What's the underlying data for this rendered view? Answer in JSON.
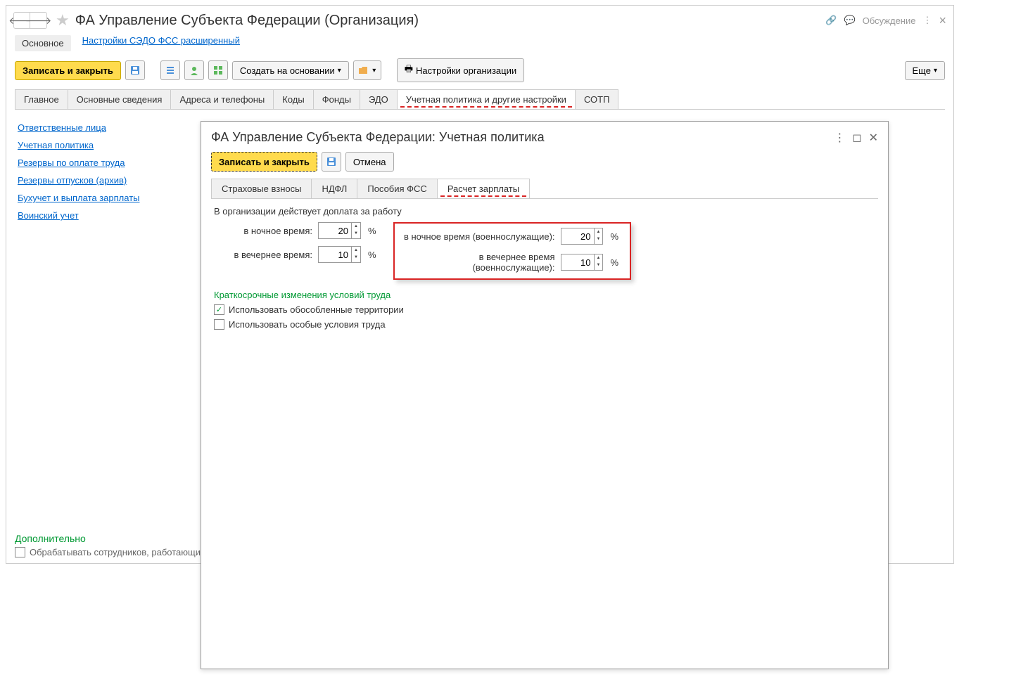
{
  "header": {
    "title": "ФА Управление Субъекта Федерации (Организация)",
    "discuss": "Обсуждение"
  },
  "toprow": {
    "main": "Основное",
    "link": "Настройки СЭДО ФСС расширенный"
  },
  "toolbar": {
    "save_close": "Записать и закрыть",
    "create_based": "Создать на основании",
    "org_settings": "Настройки организации",
    "more": "Еще"
  },
  "tabs": [
    "Главное",
    "Основные сведения",
    "Адреса и телефоны",
    "Коды",
    "Фонды",
    "ЭДО",
    "Учетная политика и другие настройки",
    "СОТП"
  ],
  "sidebar": {
    "links": [
      "Ответственные лица",
      "Учетная политика",
      "Резервы по оплате труда",
      "Резервы отпусков (архив)",
      "Бухучет и выплата зарплаты",
      "Воинский учет"
    ]
  },
  "footer": {
    "title": "Дополнительно",
    "chk_label": "Обрабатывать сотрудников, работающих"
  },
  "dialog": {
    "title": "ФА Управление Субъекта Федерации: Учетная политика",
    "save_close": "Записать и закрыть",
    "cancel": "Отмена",
    "tabs": [
      "Страховые взносы",
      "НДФЛ",
      "Пособия ФСС",
      "Расчет зарплаты"
    ],
    "section_text": "В организации действует доплата за работу",
    "night_label": "в ночное время:",
    "evening_label": "в вечернее время:",
    "night_mil_label": "в ночное время (военнослужащие):",
    "evening_mil_label": "в вечернее время (военнослужащие):",
    "night_val": "20",
    "evening_val": "10",
    "night_mil_val": "20",
    "evening_mil_val": "10",
    "pct": "%",
    "short_term_title": "Краткосрочные изменения условий труда",
    "chk1_label": "Использовать обособленные территории",
    "chk2_label": "Использовать особые условия труда",
    "chk1_checked": "✓"
  }
}
